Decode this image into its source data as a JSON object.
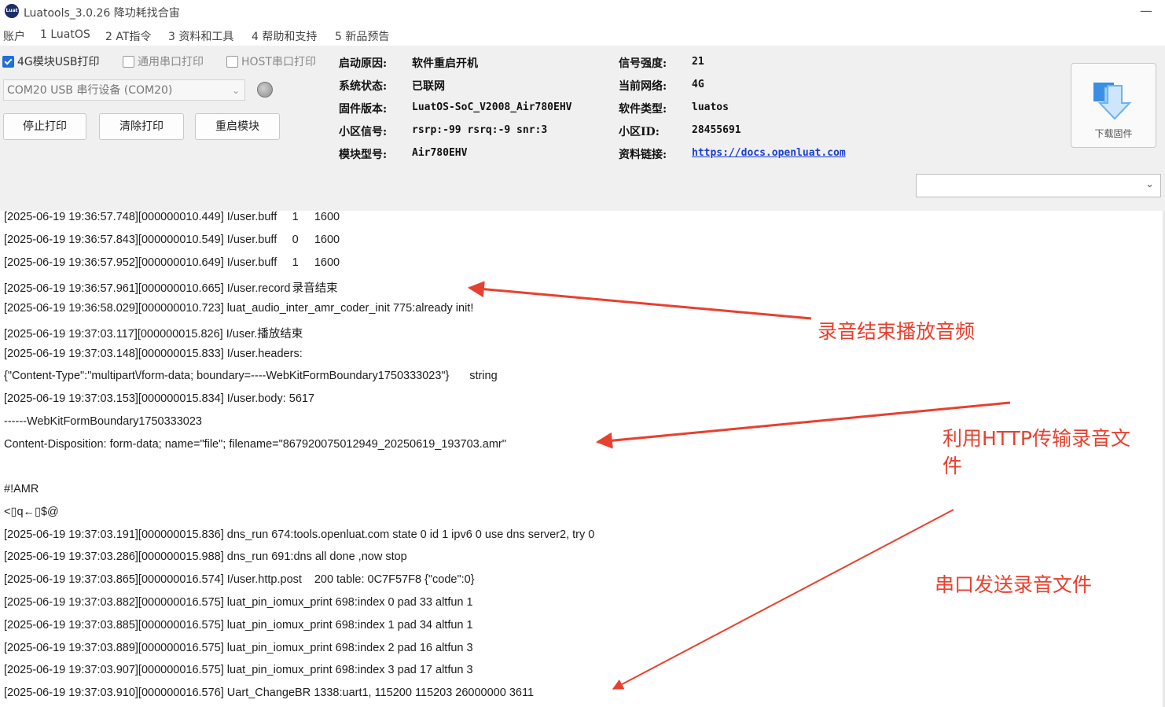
{
  "titlebar": {
    "title": "Luatools_3.0.26 降功耗找合宙",
    "logo_text": "Luat",
    "minimize_glyph": "—"
  },
  "menu": [
    "账户",
    "1 LuatOS",
    "2 AT指令",
    "3 资料和工具",
    "4 帮助和支持",
    "5 新品预告"
  ],
  "options": {
    "usb_print": {
      "label": "4G模块USB打印",
      "checked": true
    },
    "uart_print": {
      "label": "通用串口打印",
      "checked": false
    },
    "host_print": {
      "label": "HOST串口打印",
      "checked": false
    }
  },
  "port": {
    "selected": "COM20 USB 串行设备 (COM20)"
  },
  "buttons": {
    "stop_print": "停止打印",
    "clear_print": "清除打印",
    "restart_module": "重启模块",
    "download_firmware": "下载固件"
  },
  "info": {
    "boot_reason_label": "启动原因:",
    "boot_reason": "软件重启开机",
    "system_status_label": "系统状态:",
    "system_status": "已联网",
    "firmware_label": "固件版本:",
    "firmware": "LuatOS-SoC_V2008_Air780EHV",
    "cell_signal_label": "小区信号:",
    "cell_signal": "rsrp:-99 rsrq:-9 snr:3",
    "module_model_label": "模块型号:",
    "module_model": "Air780EHV",
    "signal_strength_label": "信号强度:",
    "signal_strength": "21",
    "network_label": "当前网络:",
    "network": "4G",
    "software_type_label": "软件类型:",
    "software_type": "luatos",
    "cell_id_label": "小区ID:",
    "cell_id": "28455691",
    "docs_label": "资料链接:",
    "docs_link": "https://docs.openluat.com"
  },
  "firmware_select": {
    "selected": ""
  },
  "log_lines": [
    "[2025-06-19 19:36:57.748][000000010.449] I/user.buff\t1\t1600",
    "[2025-06-19 19:36:57.843][000000010.549] I/user.buff\t0\t1600",
    "[2025-06-19 19:36:57.952][000000010.649] I/user.buff\t1\t1600",
    "[2025-06-19 19:36:57.961][000000010.665] I/user.record\t录音结束",
    "[2025-06-19 19:36:58.029][000000010.723] luat_audio_inter_amr_coder_init 775:already init!",
    "[2025-06-19 19:37:03.117][000000015.826] I/user.播放结束",
    "[2025-06-19 19:37:03.148][000000015.833] I/user.headers:",
    "{\"Content-Type\":\"multipart\\/form-data; boundary=----WebKitFormBoundary1750333023\"}\tstring",
    "[2025-06-19 19:37:03.153][000000015.834] I/user.body: 5617",
    "------WebKitFormBoundary1750333023",
    "Content-Disposition: form-data; name=\"file\"; filename=\"867920075012949_20250619_193703.amr\"",
    "",
    "#!AMR",
    "<▯q←▯$@",
    "[2025-06-19 19:37:03.191][000000015.836] dns_run 674:tools.openluat.com state 0 id 1 ipv6 0 use dns server2, try 0",
    "[2025-06-19 19:37:03.286][000000015.988] dns_run 691:dns all done ,now stop",
    "[2025-06-19 19:37:03.865][000000016.574] I/user.http.post\t200\ttable: 0C7F57F8 {\"code\":0}",
    "[2025-06-19 19:37:03.882][000000016.575] luat_pin_iomux_print 698:index 0 pad 33 altfun 1",
    "[2025-06-19 19:37:03.885][000000016.575] luat_pin_iomux_print 698:index 1 pad 34 altfun 1",
    "[2025-06-19 19:37:03.889][000000016.575] luat_pin_iomux_print 698:index 2 pad 16 altfun 3",
    "[2025-06-19 19:37:03.907][000000016.575] luat_pin_iomux_print 698:index 3 pad 17 altfun 3",
    "[2025-06-19 19:37:03.910][000000016.576] Uart_ChangeBR 1338:uart1, 115200 115203 26000000 3611"
  ],
  "annotations": {
    "record_end": "录音结束播放音频",
    "http_upload_line1": "利用HTTP传输录音文",
    "http_upload_line2": "件",
    "uart_send": "串口发送录音文件"
  },
  "colors": {
    "annotation": "#e8402e",
    "link": "#1a3fd1",
    "checkbox": "#1e6fd9",
    "panel": "#f0f0f0"
  },
  "icons": {
    "download": "download-arrow-icon",
    "status": "status-led-icon"
  }
}
